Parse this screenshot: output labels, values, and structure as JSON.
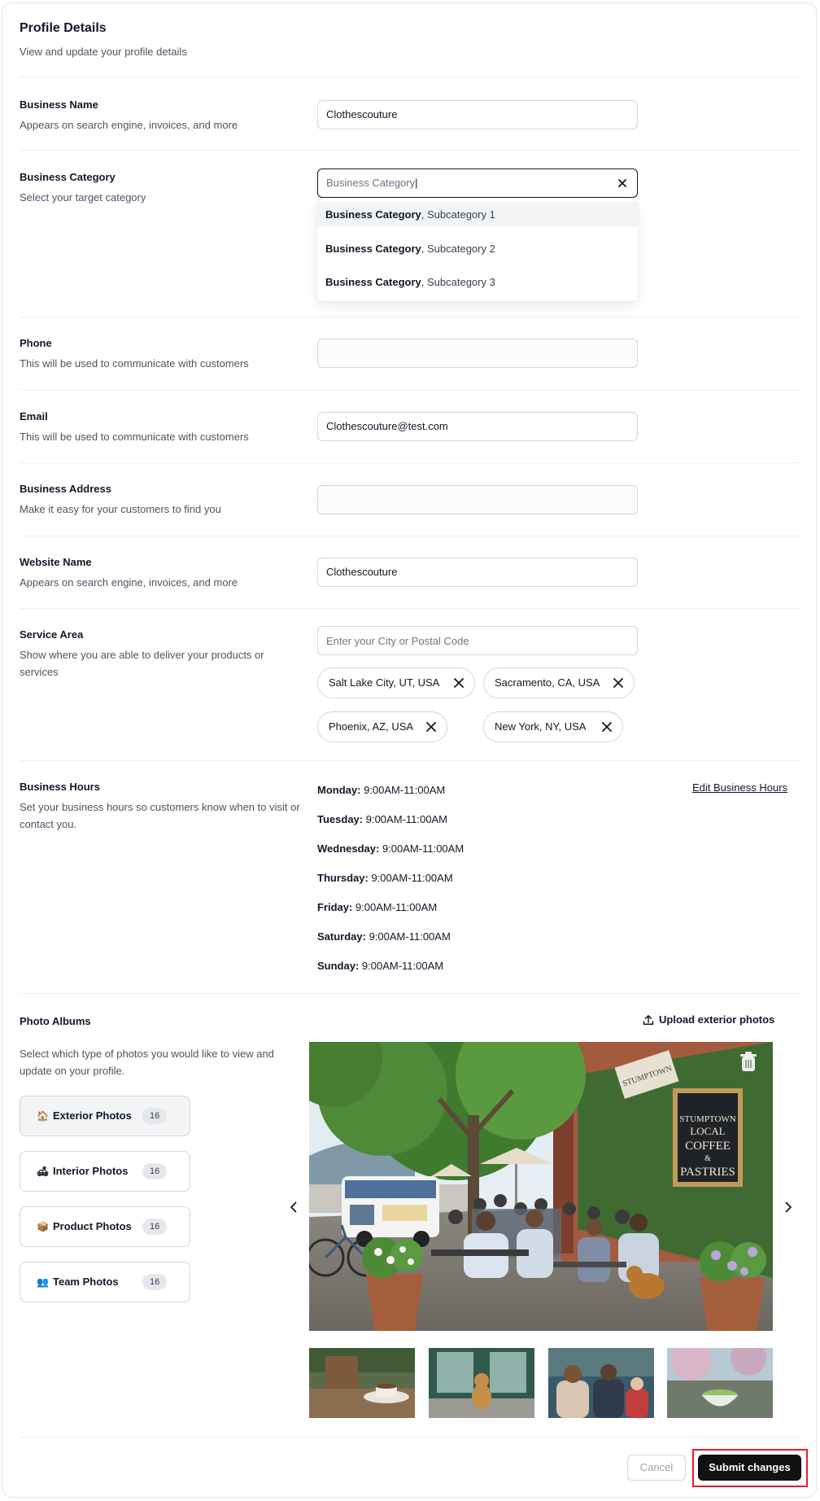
{
  "header": {
    "title": "Profile Details",
    "subtitle": "View and update your profile details"
  },
  "business_name": {
    "label": "Business Name",
    "help": "Appears on search engine, invoices, and more",
    "value": "Clothescouture"
  },
  "business_category": {
    "label": "Business Category",
    "help": "Select your target category",
    "input_text": "Business Category",
    "options": [
      {
        "main": "Business Category",
        "sub": ", Subcategory 1"
      },
      {
        "main": "Business Category",
        "sub": ", Subcategory 2"
      },
      {
        "main": "Business Category",
        "sub": ", Subcategory 3"
      }
    ]
  },
  "phone": {
    "label": "Phone",
    "help": "This will be used to communicate with customers",
    "value": ""
  },
  "email": {
    "label": "Email",
    "help": "This will be used to communicate with customers",
    "value": "Clothescouture@test.com"
  },
  "business_address": {
    "label": "Business Address",
    "help": "Make it easy for your customers to find you",
    "value": ""
  },
  "website_name": {
    "label": "Website Name",
    "help": "Appears on search engine, invoices, and more",
    "value": "Clothescouture"
  },
  "service_area": {
    "label": "Service Area",
    "help": "Show where you are able to deliver your products or services",
    "placeholder": "Enter your City or Postal Code",
    "chips": [
      "Salt Lake City, UT, USA",
      "Sacramento, CA, USA",
      "Phoenix, AZ, USA",
      "New York, NY, USA"
    ]
  },
  "business_hours": {
    "label": "Business Hours",
    "help": "Set your business hours so customers know when to visit or contact you.",
    "edit_link": "Edit Business Hours",
    "days": [
      {
        "day": "Monday:",
        "hours": " 9:00AM-11:00AM"
      },
      {
        "day": "Tuesday:",
        "hours": " 9:00AM-11:00AM"
      },
      {
        "day": "Wednesday:",
        "hours": " 9:00AM-11:00AM"
      },
      {
        "day": "Thursday:",
        "hours": " 9:00AM-11:00AM"
      },
      {
        "day": "Friday:",
        "hours": " 9:00AM-11:00AM"
      },
      {
        "day": "Saturday:",
        "hours": " 9:00AM-11:00AM"
      },
      {
        "day": "Sunday:",
        "hours": " 9:00AM-11:00AM"
      }
    ]
  },
  "photo_albums": {
    "label": "Photo Albums",
    "help": "Select which type of photos you would like to view and update on your profile.",
    "upload_label": "Upload exterior photos",
    "albums": [
      {
        "icon": "🏠",
        "label": "Exterior Photos",
        "count": "16"
      },
      {
        "icon": "🛋",
        "label": "Interior Photos",
        "count": "16"
      },
      {
        "icon": "📦",
        "label": "Product Photos",
        "count": "16"
      },
      {
        "icon": "👥",
        "label": "Team Photos",
        "count": "16"
      }
    ],
    "main_sign": {
      "line1": "STUMPTOWN",
      "line2": "LOCAL",
      "line3": "COFFEE",
      "line4": "&",
      "line5": "PASTRIES"
    },
    "awning_text": "STUMPTOWN"
  },
  "footer": {
    "cancel": "Cancel",
    "submit": "Submit changes"
  },
  "colors": {
    "primary_button": "#111111",
    "highlight_border": "#e11d2e",
    "selected_album_bg": "#f3f4f6"
  }
}
